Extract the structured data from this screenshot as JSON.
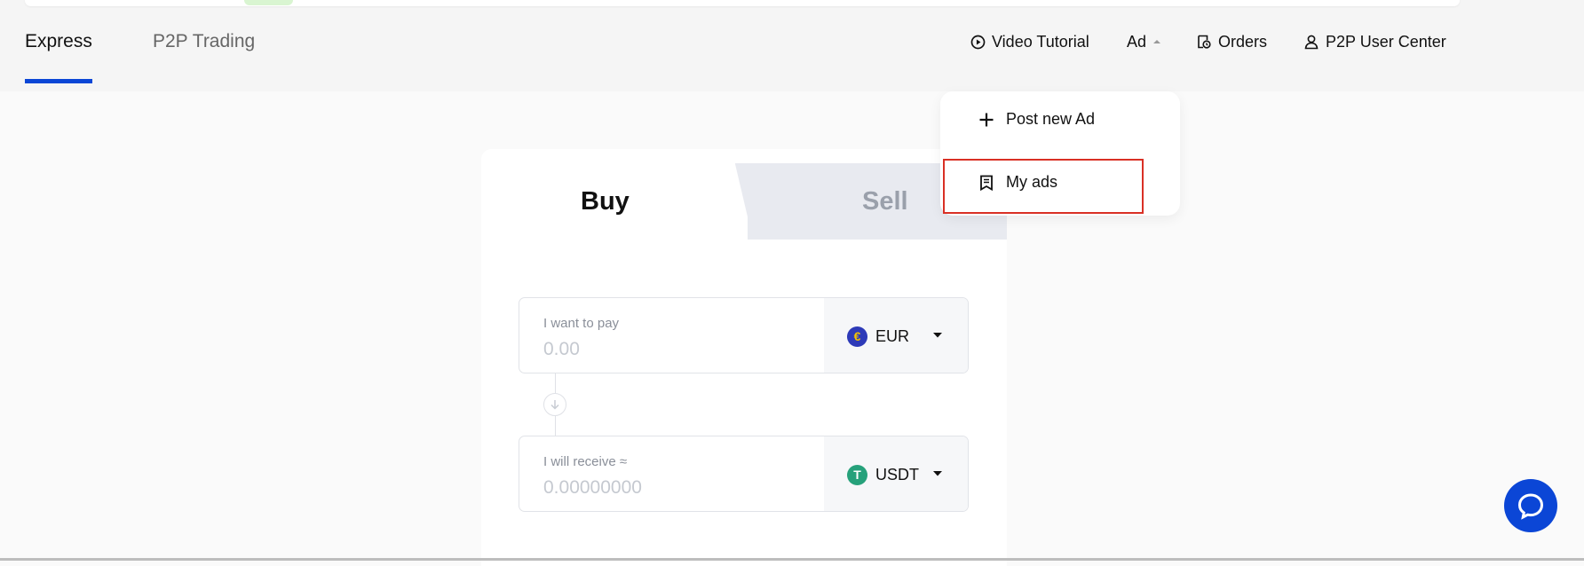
{
  "tabs": {
    "express": "Express",
    "p2p_trading": "P2P Trading"
  },
  "nav": {
    "video_tutorial": "Video Tutorial",
    "ad": "Ad",
    "orders": "Orders",
    "user_center": "P2P User Center"
  },
  "ad_menu": {
    "post_new": "Post new Ad",
    "my_ads": "My ads"
  },
  "trade": {
    "buy": "Buy",
    "sell": "Sell",
    "pay": {
      "label": "I want to pay",
      "placeholder": "0.00",
      "currency": "EUR",
      "currency_symbol": "€"
    },
    "receive": {
      "label": "I will receive ≈",
      "placeholder": "0.00000000",
      "currency": "USDT",
      "currency_symbol": "T"
    }
  },
  "colors": {
    "accent": "#0b46d6",
    "highlight": "#d93025",
    "eur_coin": "#2d3ab8",
    "usdt_coin": "#26a17b"
  },
  "icons": {
    "video": "play-circle-icon",
    "ad_toggle": "caret-up-icon",
    "orders": "orders-icon",
    "user": "user-icon",
    "post_new": "plus-icon",
    "my_ads": "receipt-icon",
    "chat": "chat-bubble-icon"
  }
}
